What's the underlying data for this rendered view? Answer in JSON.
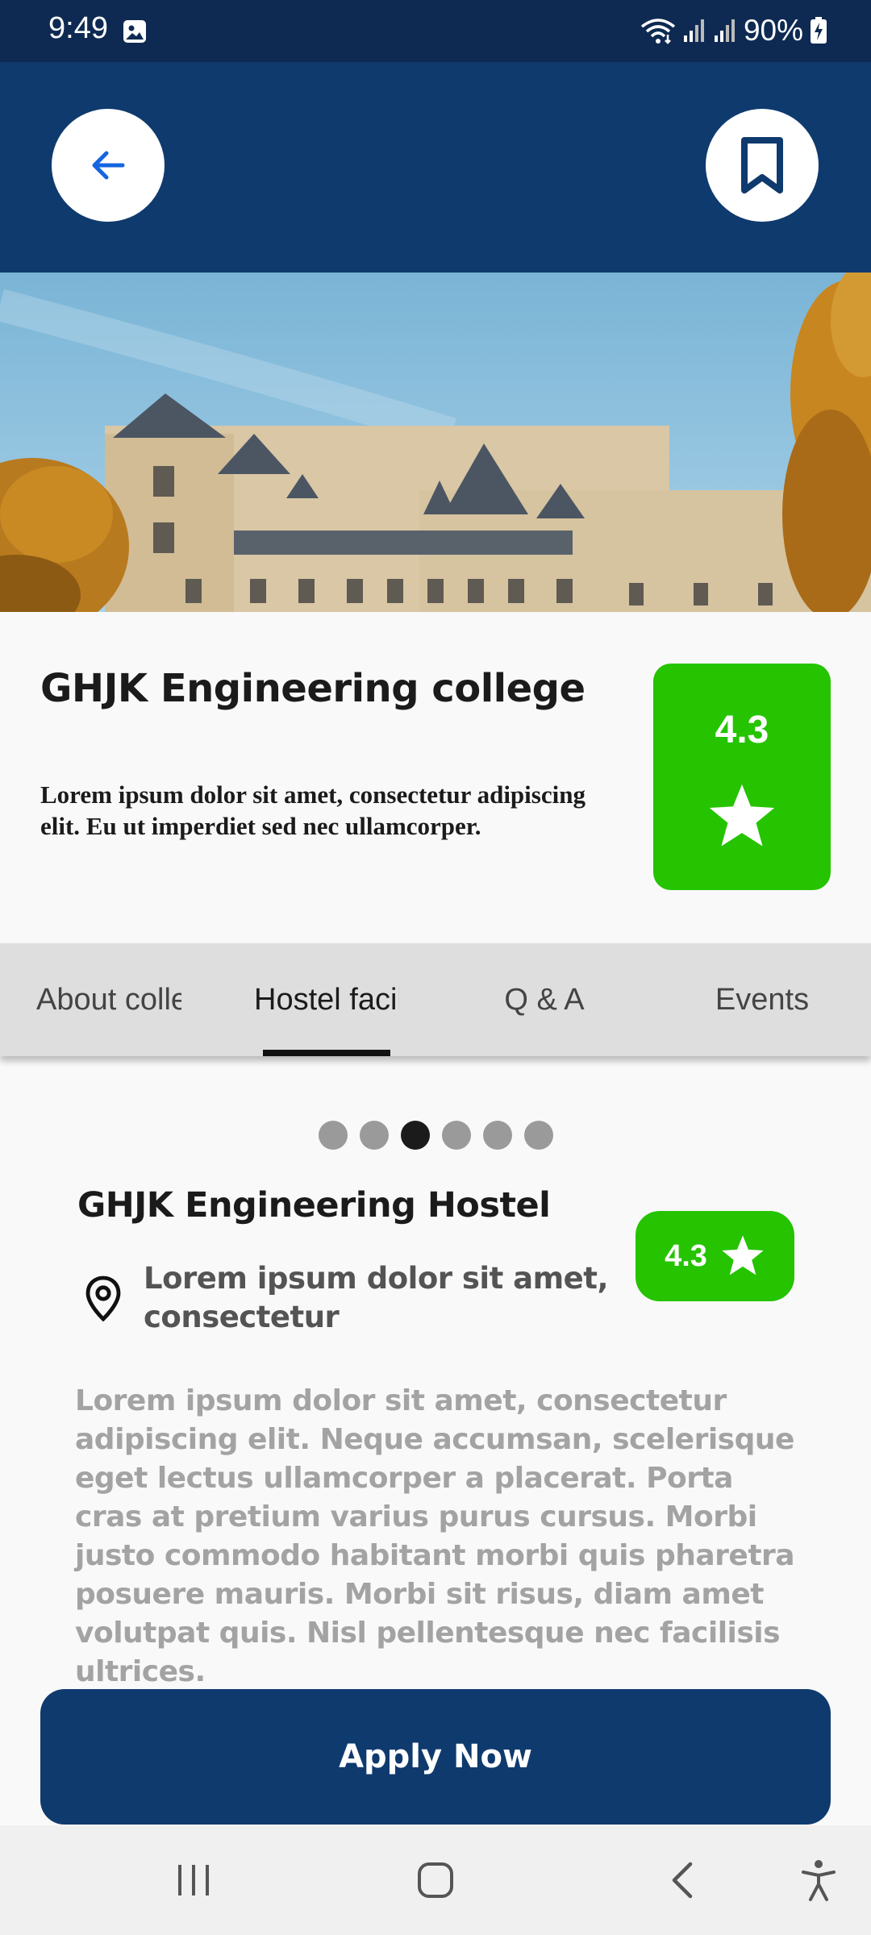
{
  "status_bar": {
    "time": "9:49",
    "battery": "90%",
    "icons": [
      "image-notification-icon",
      "wifi-icon",
      "signal-icon",
      "signal-icon",
      "battery-charging-icon"
    ]
  },
  "header": {
    "back_icon": "arrow-left-icon",
    "bookmark_icon": "bookmark-icon"
  },
  "hero": {
    "image": "college-building-photo"
  },
  "college": {
    "name": "GHJK Engineering college",
    "description": "Lorem ipsum dolor sit amet, consectetur adipiscing elit. Eu ut imperdiet sed nec ullamcorper.",
    "rating": "4.3"
  },
  "tabs": [
    {
      "label": "About college",
      "selected": false
    },
    {
      "label": "Hostel facilities",
      "selected": true
    },
    {
      "label": "Q & A",
      "selected": false
    },
    {
      "label": "Events",
      "selected": false
    }
  ],
  "carousel": {
    "count": 6,
    "active_index": 2
  },
  "hostel": {
    "name": "GHJK Engineering Hostel",
    "address": "Lorem ipsum dolor sit amet, consectetur",
    "rating": "4.3",
    "description": "Lorem ipsum dolor sit amet, consectetur adipiscing elit. Neque accumsan, scelerisque eget lectus ullamcorper a placerat. Porta cras at pretium varius purus cursus. Morbi justo commodo habitant morbi quis pharetra posuere mauris. Morbi sit risus, diam amet volutpat quis. Nisl pellentesque nec facilisis ultrices."
  },
  "apply_button": {
    "label": "Apply Now"
  },
  "colors": {
    "primary": "#0f3a6e",
    "status_bar": "#0e2a52",
    "rating_green": "#25c300",
    "back_arrow": "#1565e0"
  },
  "nav_bar": {
    "icons": [
      "recent-apps-icon",
      "home-icon",
      "back-icon",
      "accessibility-icon"
    ]
  }
}
